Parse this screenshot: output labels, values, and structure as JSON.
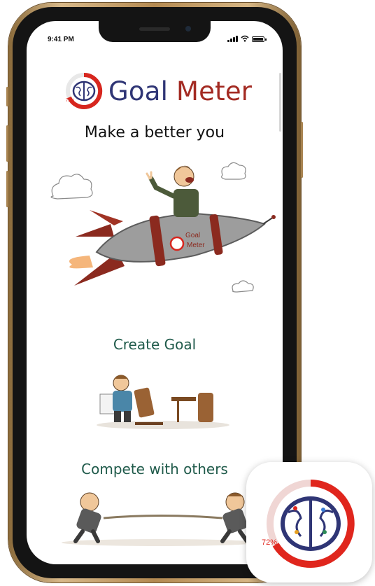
{
  "status_bar": {
    "time": "9:41 PM"
  },
  "header": {
    "title_part1": "Goal",
    "title_part2": "Meter",
    "tagline": "Make a better you"
  },
  "logo": {
    "percent": "79%"
  },
  "rocket": {
    "label_line1": "Goal",
    "label_line2": "Meter"
  },
  "sections": [
    {
      "label": "Create Goal"
    },
    {
      "label": "Compete with others"
    }
  ],
  "app_icon": {
    "percent": "72%"
  },
  "colors": {
    "brand_blue": "#2f3575",
    "brand_red": "#a32a22",
    "section_green": "#1f5a4a",
    "frame_gold": "#b48a52"
  }
}
